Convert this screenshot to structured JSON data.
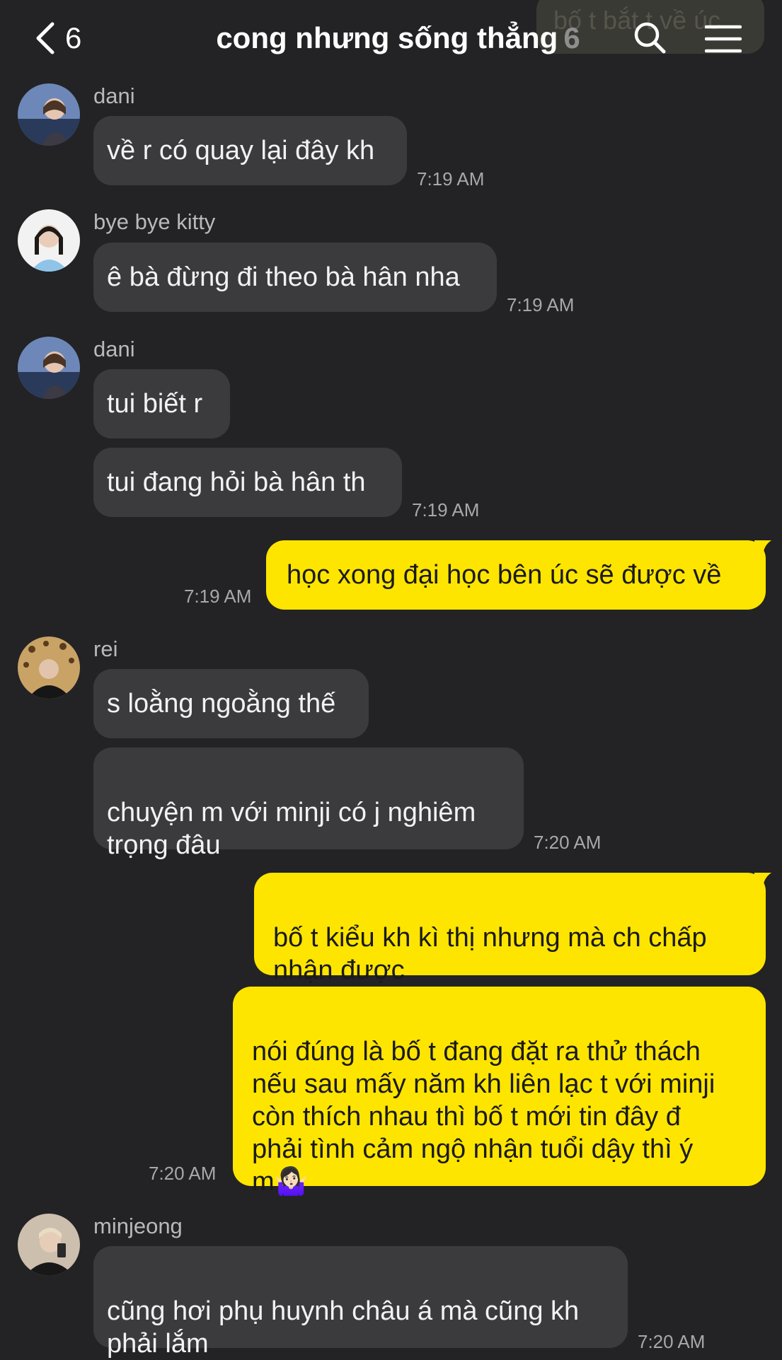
{
  "header": {
    "back_count": "6",
    "title": "cong nhưng sống thẳng",
    "member_count": "6",
    "ghost_preview": "bố t bắt t về úc"
  },
  "messages": [
    {
      "sender": "dani",
      "texts": [
        "về r có quay lại đây kh"
      ],
      "time": "7:19 AM"
    },
    {
      "sender": "bye bye kitty",
      "texts": [
        "ê bà đừng đi theo bà hân nha"
      ],
      "time": "7:19 AM"
    },
    {
      "sender": "dani",
      "texts": [
        "tui biết r",
        "tui đang hỏi bà hân th"
      ],
      "time": "7:19 AM"
    },
    {
      "mine": true,
      "texts": [
        "học xong đại học bên úc sẽ được về"
      ],
      "time": "7:19 AM"
    },
    {
      "sender": "rei",
      "texts": [
        "s loằng ngoằng thế",
        "chuyện m với minji có j nghiêm\ntrọng đâu"
      ],
      "time": "7:20 AM"
    },
    {
      "mine": true,
      "texts": [
        "bố t kiểu kh kì thị nhưng mà ch chấp\nnhận được",
        "nói đúng là bố t đang đặt ra thử thách\nnếu sau mấy năm kh liên lạc t với minji\ncòn thích nhau thì bố t mới tin đây đ\nphải tình cảm ngộ nhận tuổi dậy thì ý\nm🤷🏻‍♀️"
      ],
      "time": "7:20 AM"
    },
    {
      "sender": "minjeong",
      "texts": [
        "cũng hơi phụ huynh châu á mà cũng kh\nphải lắm"
      ],
      "time": "7:20 AM"
    }
  ],
  "colors": {
    "background": "#232325",
    "incoming_bubble": "#3b3b3d",
    "outgoing_bubble": "#fee500",
    "timestamp": "#a8a8a8"
  }
}
